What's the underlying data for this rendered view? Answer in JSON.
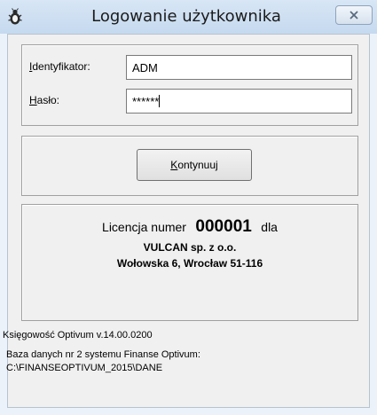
{
  "window": {
    "title": "Logowanie użytkownika"
  },
  "login": {
    "id_label_underlined": "I",
    "id_label_rest": "dentyfikator:",
    "id_value": "ADM",
    "password_label_underlined": "H",
    "password_label_rest": "asło:",
    "password_value": "******"
  },
  "actions": {
    "continue_underlined": "K",
    "continue_rest": "ontynuuj"
  },
  "license": {
    "prefix": "Licencja numer",
    "number": "000001",
    "suffix": "dla",
    "company": "VULCAN sp. z o.o.",
    "address": "Wołowska 6, Wrocław 51-116"
  },
  "info": {
    "version": "Księgowość Optivum v.14.00.0200",
    "database": "Baza danych nr 2 systemu Finanse Optivum:",
    "path": "C:\\FINANSEOPTIVUM_2015\\DANE"
  },
  "colors": {
    "titlebar": "#c5d9ef",
    "client_background": "#f0f0f0"
  },
  "icons": {
    "app": "bug-icon",
    "close": "close-icon"
  }
}
